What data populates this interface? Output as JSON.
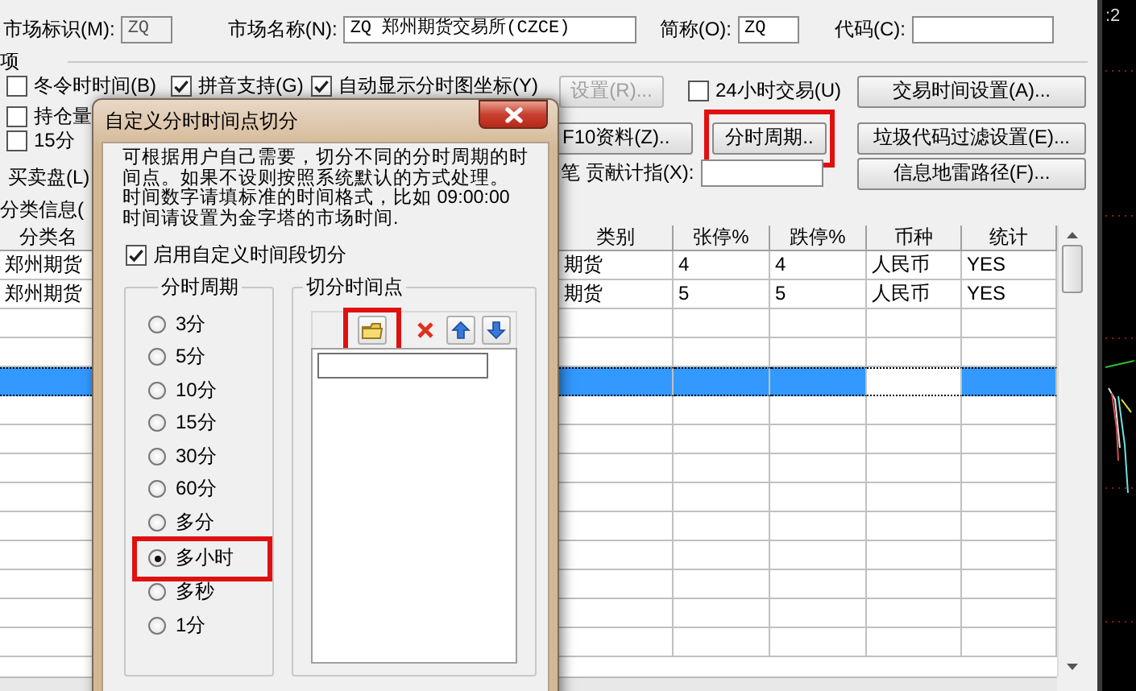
{
  "market_row": [
    {
      "label": "市场标识(M):",
      "value": "ZQ",
      "disabled": true
    },
    {
      "label": "市场名称(N):",
      "value": "ZQ 郑州期货交易所(CZCE)",
      "disabled": false
    },
    {
      "label": "简称(O):",
      "value": "ZQ",
      "disabled": false
    },
    {
      "label": "代码(C):",
      "disabled": false
    }
  ],
  "options_title": "项",
  "left_options": [
    {
      "kind": "checkbox",
      "label": "冬令时时间(B)",
      "checked": false
    },
    {
      "kind": "checkbox",
      "label": "拼音支持(G)",
      "checked": true
    },
    {
      "kind": "checkbox",
      "label": "自动显示分时图坐标(Y)",
      "checked": true
    },
    {
      "kind": "checkbox",
      "label": "持仓量",
      "checked": false
    },
    {
      "kind": "checkbox",
      "label": "15分",
      "checked": false
    },
    {
      "kind": "label",
      "label": "买卖盘(L)"
    },
    {
      "kind": "label",
      "label": "分类信息("
    }
  ],
  "right_options": [
    {
      "kind": "button",
      "label": "设置(R)...",
      "disabled": true,
      "highlighted": false
    },
    {
      "kind": "checkbox",
      "label": "24小时交易(U)",
      "checked": false
    },
    {
      "kind": "button",
      "label": "交易时间设置(A)...",
      "disabled": false,
      "highlighted": false
    },
    {
      "kind": "button",
      "label": "F10资料(Z)..",
      "disabled": false,
      "highlighted": false
    },
    {
      "kind": "button",
      "label": "分时周期..",
      "disabled": false,
      "highlighted": true
    },
    {
      "kind": "button",
      "label": "垃圾代码过滤设置(E)...",
      "disabled": false,
      "highlighted": false
    },
    {
      "kind": "field",
      "label": "笔 贡献计指(X):"
    },
    {
      "kind": "button",
      "label": "信息地雷路径(F)...",
      "disabled": false,
      "highlighted": false
    }
  ],
  "table": {
    "columns": [
      "分类名",
      "类别",
      "张停%",
      "跌停%",
      "币种",
      "统计"
    ],
    "rows": [
      {
        "selected": false,
        "cells": [
          {
            "text": "郑州期货"
          },
          {
            "text": "期货"
          },
          {
            "text": "4"
          },
          {
            "text": "4"
          },
          {
            "text": "人民币"
          },
          {
            "text": "YES"
          }
        ]
      },
      {
        "selected": false,
        "cells": [
          {
            "text": "郑州期货"
          },
          {
            "text": "期货"
          },
          {
            "text": "5"
          },
          {
            "text": "5"
          },
          {
            "text": "人民币"
          },
          {
            "text": "YES"
          }
        ]
      },
      {
        "selected": false
      },
      {
        "selected": false
      },
      {
        "selected": true,
        "cells": [
          {
            "focused": false
          },
          {
            "focused": false
          },
          {
            "focused": false
          },
          {
            "focused": false
          },
          {
            "focused": true
          },
          {
            "focused": false
          }
        ]
      },
      {
        "selected": false
      },
      {
        "selected": false
      },
      {
        "selected": false
      },
      {
        "selected": false
      },
      {
        "selected": false
      },
      {
        "selected": false
      },
      {
        "selected": false
      },
      {
        "selected": false
      },
      {
        "selected": false
      }
    ]
  },
  "chart_strip": {
    "time_label": ":2"
  },
  "dialog": {
    "title": "自定义分时时间点切分",
    "description_lines": [
      "可根据用户自己需要，切分不同的分时周期的时",
      "间点。如果不设则按照系统默认的方式处理。",
      "时间数字请填标准的时间格式，比如 09:00:00",
      "时间请设置为金字塔的市场时间."
    ],
    "enable": {
      "label": "启用自定义时间段切分",
      "checked": true
    },
    "period_group": {
      "title": "分时周期",
      "options": [
        {
          "label": "3分",
          "selected": false,
          "highlighted": false
        },
        {
          "label": "5分",
          "selected": false,
          "highlighted": false
        },
        {
          "label": "10分",
          "selected": false,
          "highlighted": false
        },
        {
          "label": "15分",
          "selected": false,
          "highlighted": false
        },
        {
          "label": "30分",
          "selected": false,
          "highlighted": false
        },
        {
          "label": "60分",
          "selected": false,
          "highlighted": false
        },
        {
          "label": "多分",
          "selected": false,
          "highlighted": false
        },
        {
          "label": "多小时",
          "selected": true,
          "highlighted": true
        },
        {
          "label": "多秒",
          "selected": false,
          "highlighted": false
        },
        {
          "label": "1分",
          "selected": false,
          "highlighted": false
        }
      ]
    },
    "points_group": {
      "title": "切分时间点",
      "toolbar": [
        {
          "kind": "folder",
          "highlighted": true
        },
        {
          "kind": "delete",
          "highlighted": false
        },
        {
          "kind": "up",
          "highlighted": false
        },
        {
          "kind": "down",
          "highlighted": false
        }
      ]
    }
  }
}
